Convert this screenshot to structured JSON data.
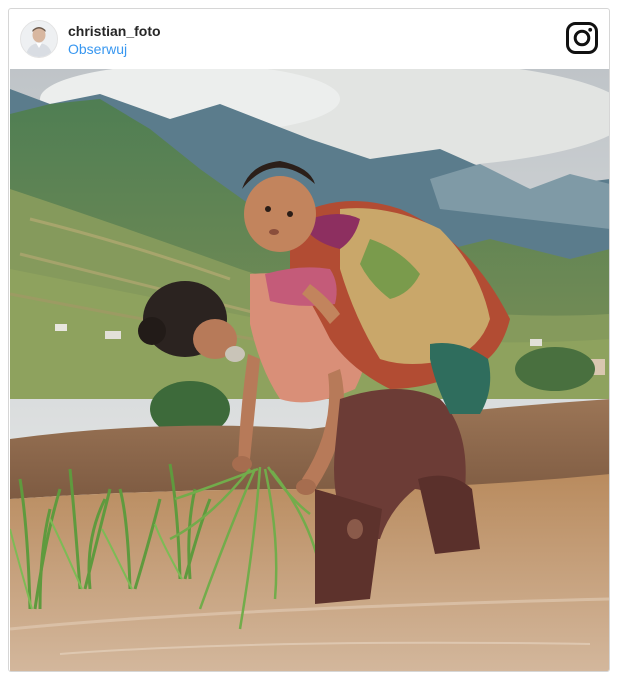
{
  "post": {
    "username": "christian_foto",
    "follow_label": "Obserwuj",
    "platform_icon": "instagram-icon",
    "avatar_icon": "user-avatar",
    "photo_subject": "photo"
  },
  "colors": {
    "username": "#262626",
    "follow_link": "#3897f0",
    "border": "#d6d6d6"
  }
}
